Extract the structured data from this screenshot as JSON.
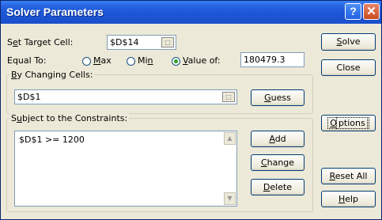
{
  "window": {
    "title": "Solver Parameters",
    "help_glyph": "?",
    "close_glyph": "✕"
  },
  "target": {
    "label_prefix": "S",
    "label_hot": "e",
    "label_suffix": "t Target Cell:",
    "value": "$D$14"
  },
  "equal_to": {
    "label": "Equal To:",
    "options": [
      {
        "pre": "",
        "hot": "M",
        "post": "ax",
        "checked": false
      },
      {
        "pre": "Mi",
        "hot": "n",
        "post": "",
        "checked": false
      },
      {
        "pre": "",
        "hot": "V",
        "post": "alue of:",
        "checked": true
      }
    ],
    "value_of": "180479.3"
  },
  "changing": {
    "label_hot": "B",
    "label_rest": "y Changing Cells:",
    "value": "$D$1"
  },
  "constraints": {
    "label_pre": "S",
    "label_hot": "u",
    "label_rest": "bject to the Constraints:",
    "items": [
      "$D$1 >= 1200"
    ]
  },
  "buttons": {
    "solve": {
      "hot": "S",
      "rest": "olve"
    },
    "close": {
      "pre": "Close"
    },
    "guess": {
      "hot": "G",
      "rest": "uess"
    },
    "options": {
      "hot": "O",
      "rest": "ptions"
    },
    "add": {
      "hot": "A",
      "rest": "dd"
    },
    "change": {
      "hot": "C",
      "rest": "hange"
    },
    "delete": {
      "hot": "D",
      "rest": "elete"
    },
    "reset_all": {
      "hot": "R",
      "rest": "eset All"
    },
    "help": {
      "hot": "H",
      "rest": "elp"
    }
  }
}
